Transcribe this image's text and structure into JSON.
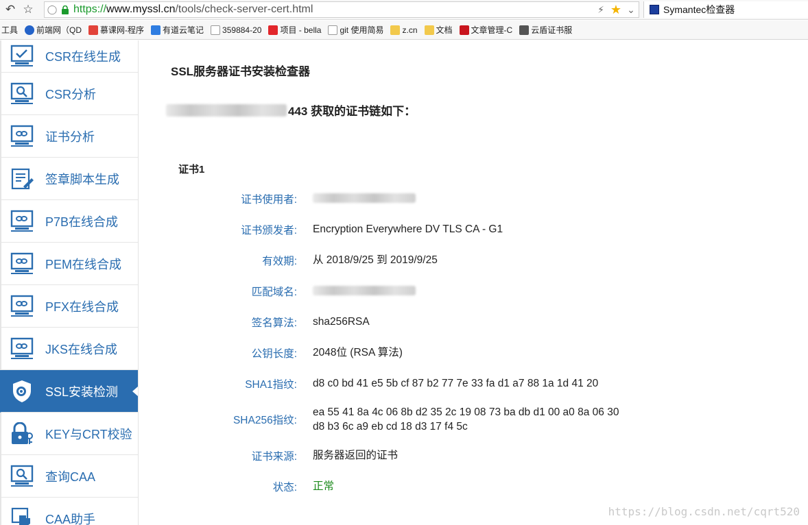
{
  "browser": {
    "url_proto": "https://",
    "url_host": "www.myssl.cn",
    "url_path": "/tools/check-server-cert.html",
    "search_label": "Symantec检查器"
  },
  "bookmarks": [
    {
      "label": "工具",
      "icon": "none"
    },
    {
      "label": "前端网（QD",
      "icon": "circle-blue"
    },
    {
      "label": "慕课网-程序",
      "icon": "flame-red"
    },
    {
      "label": "有道云笔记",
      "icon": "note-blue"
    },
    {
      "label": "359884-20",
      "icon": "page"
    },
    {
      "label": "项目 - bella",
      "icon": "g-red"
    },
    {
      "label": "git 使用简易",
      "icon": "page"
    },
    {
      "label": "z.cn",
      "icon": "folder"
    },
    {
      "label": "文档",
      "icon": "folder"
    },
    {
      "label": "文章管理-C",
      "icon": "c-red"
    },
    {
      "label": "云盾证书服",
      "icon": "cloud-shield"
    }
  ],
  "sidebar": {
    "items": [
      {
        "label": "CSR在线生成",
        "icon": "monitor-check-icon"
      },
      {
        "label": "CSR分析",
        "icon": "monitor-search-icon"
      },
      {
        "label": "证书分析",
        "icon": "monitor-link-icon"
      },
      {
        "label": "签章脚本生成",
        "icon": "document-pen-icon"
      },
      {
        "label": "P7B在线合成",
        "icon": "monitor-link-icon"
      },
      {
        "label": "PEM在线合成",
        "icon": "monitor-link-icon"
      },
      {
        "label": "PFX在线合成",
        "icon": "monitor-link-icon"
      },
      {
        "label": "JKS在线合成",
        "icon": "monitor-link-icon"
      },
      {
        "label": "SSL安装检测",
        "icon": "shield-gear-icon"
      },
      {
        "label": "KEY与CRT校验",
        "icon": "lock-key-icon"
      },
      {
        "label": "查询CAA",
        "icon": "monitor-search-icon"
      },
      {
        "label": "CAA助手",
        "icon": "hand-icon"
      }
    ],
    "active_index": 8
  },
  "main": {
    "title": "SSL服务器证书安装检查器",
    "chain_suffix": "443 获取的证书链如下：",
    "cert_title": "证书1",
    "fields": [
      {
        "key": "证书使用者:",
        "value": "",
        "redacted": true
      },
      {
        "key": "证书颁发者:",
        "value": "Encryption Everywhere DV TLS CA - G1"
      },
      {
        "key": "有效期:",
        "value": "从 2018/9/25 到 2019/9/25"
      },
      {
        "key": "匹配域名:",
        "value": "",
        "redacted": true
      },
      {
        "key": "签名算法:",
        "value": "sha256RSA"
      },
      {
        "key": "公钥长度:",
        "value": "2048位 (RSA 算法)"
      },
      {
        "key": "SHA1指纹:",
        "value": "d8 c0 bd 41 e5 5b cf 87 b2 77 7e 33 fa d1 a7 88 1a 1d 41 20"
      },
      {
        "key": "SHA256指纹:",
        "value": "ea 55 41 8a 4c 06 8b d2 35 2c 19 08 73 ba db d1 00 a0 8a 06 30",
        "value2": "d8 b3 6c a9 eb cd 18 d3 17 f4 5c"
      },
      {
        "key": "证书来源:",
        "value": "服务器返回的证书"
      },
      {
        "key": "状态:",
        "value": "正常",
        "status": "ok"
      }
    ]
  },
  "watermark": "https://blog.csdn.net/cqrt520",
  "colors": {
    "accent": "#2a6db0",
    "ok": "#1a8a1a",
    "url_secure": "#1a9a2c"
  }
}
